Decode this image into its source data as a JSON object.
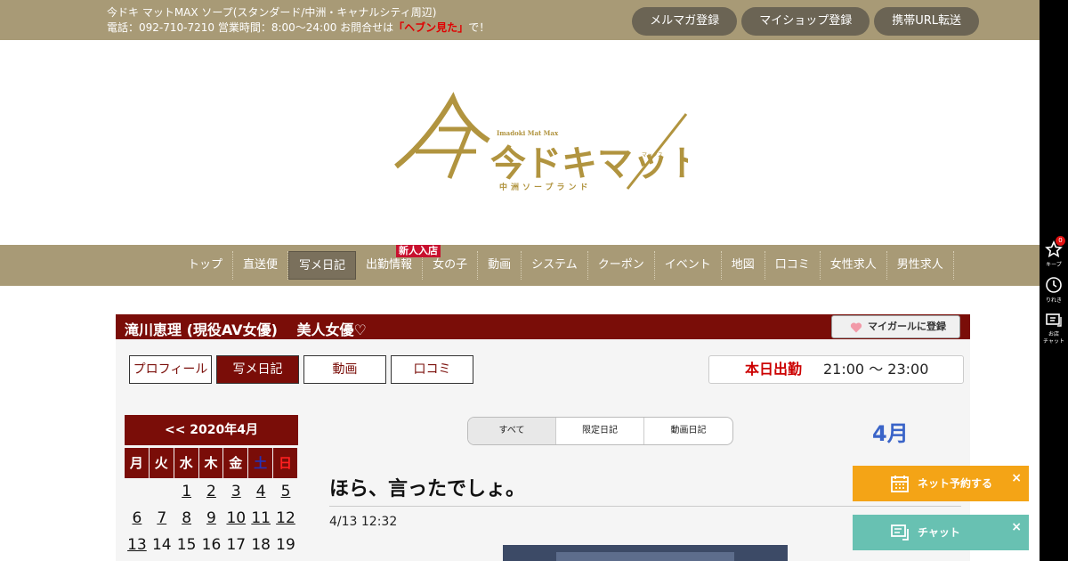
{
  "topbar": {
    "shop_line": "今ドキ マットMAX ソープ(スタンダード/中洲・キャナルシティ周辺)",
    "phone_text": "電話：092-710-7210 営業時間：8:00～24:00 お問合せは",
    "heaven_text": "「ヘブン見た」",
    "tail_text": "で！",
    "buttons": [
      "メルマガ登録",
      "マイショップ登録",
      "携帯URL転送"
    ]
  },
  "logo": {
    "main_text": "今ドキマットMAX",
    "sub_en": "Imadoki Mat Max",
    "sub_jp": "中洲ソープランド",
    "kana": "マックス",
    "color": "#b1943f"
  },
  "nav": {
    "items": [
      "トップ",
      "直送便",
      "写メ日記",
      "出勤情報",
      "女の子",
      "動画",
      "システム",
      "クーポン",
      "イベント",
      "地図",
      "口コミ",
      "女性求人",
      "男性求人"
    ],
    "badge": "新人入店"
  },
  "side_tools": {
    "keep_label": "キープ",
    "keep_count": "0",
    "history_label": "りれき",
    "chat_label": "お店\nチャット"
  },
  "girl": {
    "name": "滝川恵理 (現役AV女優)　 美人女優♡",
    "mygirl_button": "マイガールに登録"
  },
  "profile_tabs": [
    "プロフィール",
    "写メ日記",
    "動画",
    "口コミ"
  ],
  "today": {
    "label": "本日出勤",
    "time": "21:00 ～ 23:00"
  },
  "calendar": {
    "header": "<< 2020年4月",
    "dows": [
      "月",
      "火",
      "水",
      "木",
      "金",
      "土",
      "日"
    ],
    "weeks": [
      [
        "",
        "",
        "1",
        "2",
        "3",
        "4",
        "5"
      ],
      [
        "6",
        "7",
        "8",
        "9",
        "10",
        "11",
        "12"
      ],
      [
        "13",
        "14",
        "15",
        "16",
        "17",
        "18",
        "19"
      ]
    ]
  },
  "diary_filter": [
    "すべて",
    "限定日記",
    "動画日記"
  ],
  "month_label": "4月",
  "post": {
    "title": "ほら、言ったでしょ。",
    "date": "4/13 12:32"
  },
  "float_buttons": {
    "reserve": "ネット予約する",
    "chat": "チャット",
    "close": "×"
  },
  "colors": {
    "bar": "#a89a76",
    "maroon": "#7a0d08",
    "reserve": "#f4a416",
    "chat": "#68c1b2"
  }
}
